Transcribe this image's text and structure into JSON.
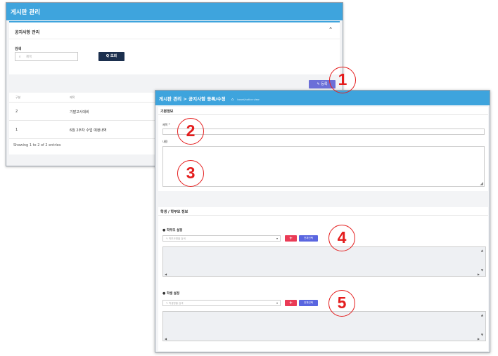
{
  "list_window": {
    "title": "게시판 관리",
    "panel_title": "공지사항 관리",
    "search_label": "검색",
    "search_placeholder": "제목",
    "search_button": "Q 조회",
    "register_button": "등록",
    "table": {
      "columns": [
        "구분",
        "제목"
      ],
      "rows": [
        [
          "2",
          "기말고사대비"
        ],
        [
          "1",
          "6월 2주차 수업 예정내역"
        ]
      ]
    },
    "footer": "Showing 1 to 2 of 2 entries"
  },
  "form_window": {
    "title": "게시판 관리 > 공지사항 등록/수정",
    "breadcrumb_sub": "board/notice.view",
    "basic_section": "기본정보",
    "title_label": "제목 *",
    "content_label": "내용",
    "target_section": "학생 / 학부모 정보",
    "parent_label": "학부모 설정",
    "parent_placeholder": "학부모명을 검색",
    "student_label": "학생 설정",
    "student_placeholder": "학생명을 검색",
    "plus_label": "+",
    "select_all_label": "전체선택"
  },
  "callouts": [
    "1",
    "2",
    "3",
    "4",
    "5"
  ],
  "colors": {
    "header_blue": "#3ea4dd",
    "navy_button": "#1b2f4e",
    "accent_red": "#e41d1d",
    "plus_red": "#ea3b56",
    "select_all_blue": "#5a66e0"
  }
}
